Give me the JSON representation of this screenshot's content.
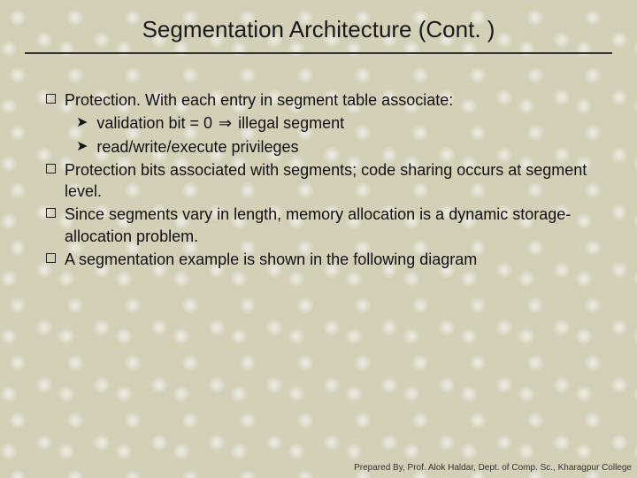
{
  "title": "Segmentation Architecture (Cont. )",
  "bullets": [
    {
      "text": "Protection.  With each entry in segment table associate:"
    },
    {
      "sub": true,
      "pre": "validation bit = 0 ",
      "sym": "⇒",
      "post": " illegal segment"
    },
    {
      "sub": true,
      "text": "read/write/execute privileges"
    },
    {
      "text": "Protection bits associated with segments; code sharing occurs at segment level."
    },
    {
      "text": "Since segments vary in length, memory allocation is a dynamic storage-allocation problem."
    },
    {
      "text": "A segmentation example is shown in the following diagram"
    }
  ],
  "footer": "Prepared By, Prof. Alok Haldar, Dept. of Comp. Sc., Kharagpur College"
}
